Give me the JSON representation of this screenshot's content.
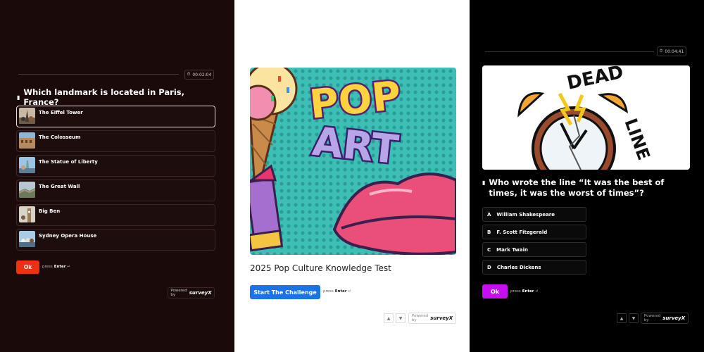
{
  "panel1": {
    "timer": "00:02:04",
    "question": "Which landmark is located in Paris, France?",
    "options": [
      {
        "label": "The Eiffel Tower",
        "selected": true
      },
      {
        "label": "The Colosseum"
      },
      {
        "label": "The Statue of Liberty"
      },
      {
        "label": "The Great Wall"
      },
      {
        "label": "Big Ben"
      },
      {
        "label": "Sydney Opera House"
      }
    ],
    "ok_label": "Ok",
    "press_label": "press",
    "enter_label": "Enter",
    "powered_label": "Powered by",
    "brand": "surveyX",
    "accent": "#ee3113"
  },
  "panel2": {
    "hero_text_1": "POP",
    "hero_text_2": "ART",
    "title": "2025 Pop Culture Knowledge Test",
    "start_label": "Start The Challenge",
    "press_label": "press",
    "enter_label": "Enter",
    "powered_label": "Powered by",
    "brand": "surveyX",
    "accent": "#1a73e8"
  },
  "panel3": {
    "timer": "00:04:41",
    "image_text_1": "DEAD",
    "image_text_2": "LINE",
    "question": "Who wrote the line “It was the best of times, it was the worst of times”?",
    "options": [
      {
        "letter": "A",
        "label": "William Shakespeare"
      },
      {
        "letter": "B",
        "label": "F. Scott Fitzgerald"
      },
      {
        "letter": "C",
        "label": "Mark Twain"
      },
      {
        "letter": "D",
        "label": "Charles Dickens"
      }
    ],
    "ok_label": "Ok",
    "press_label": "press",
    "enter_label": "Enter",
    "powered_label": "Powered by",
    "brand": "surveyX",
    "accent": "#c60ef0"
  }
}
